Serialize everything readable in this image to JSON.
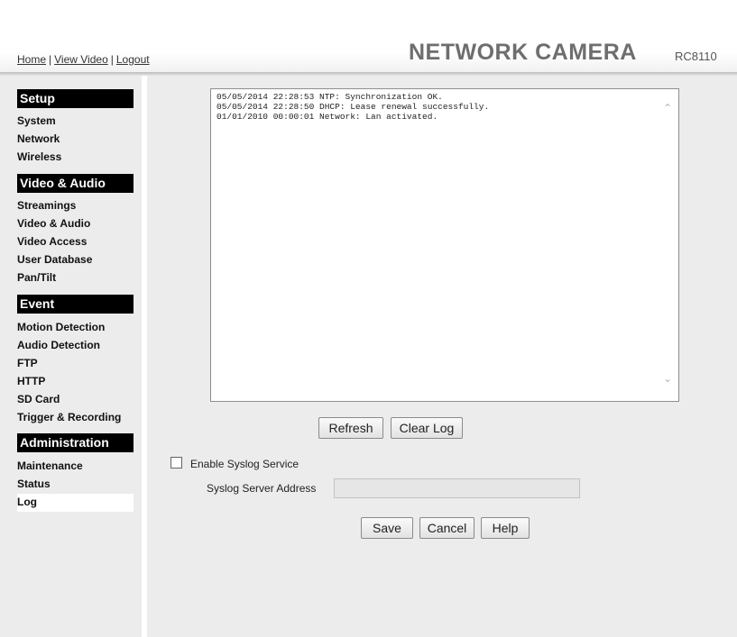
{
  "header": {
    "links": [
      "Home",
      "View Video",
      "Logout"
    ],
    "separator": "|",
    "brand": "NETWORK CAMERA",
    "model": "RC8110"
  },
  "sidebar": {
    "sections": [
      {
        "title": "Setup",
        "items": [
          "System",
          "Network",
          "Wireless"
        ]
      },
      {
        "title": "Video & Audio",
        "items": [
          "Streamings",
          "Video & Audio",
          "Video Access",
          "User Database",
          "Pan/Tilt"
        ]
      },
      {
        "title": "Event",
        "items": [
          "Motion Detection",
          "Audio Detection",
          "FTP",
          "HTTP",
          "SD Card",
          "Trigger & Recording"
        ]
      },
      {
        "title": "Administration",
        "items": [
          "Maintenance",
          "Status",
          "Log"
        ]
      }
    ],
    "active_item": "Log"
  },
  "log": {
    "lines": [
      "05/05/2014 22:28:53 NTP: Synchronization OK.",
      "05/05/2014 22:28:50 DHCP: Lease renewal successfully.",
      "01/01/2010 00:00:01 Network: Lan activated."
    ]
  },
  "log_buttons": {
    "refresh": "Refresh",
    "clear": "Clear Log"
  },
  "syslog": {
    "enable_label": "Enable Syslog Service",
    "enabled": false,
    "server_label": "Syslog Server Address",
    "server_value": ""
  },
  "form_buttons": {
    "save": "Save",
    "cancel": "Cancel",
    "help": "Help"
  },
  "icons": {
    "scroll_up": "chevron-up-icon",
    "scroll_down": "chevron-down-icon"
  }
}
